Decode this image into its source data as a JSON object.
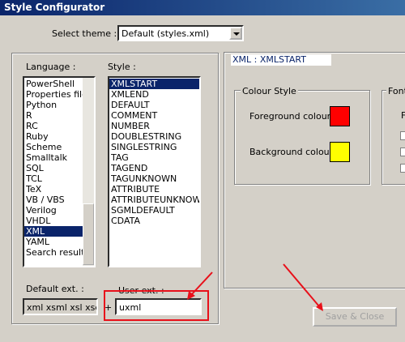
{
  "window": {
    "title": "Style Configurator"
  },
  "theme": {
    "label": "Select theme :",
    "value": "Default (styles.xml)"
  },
  "language": {
    "label": "Language :",
    "items": [
      "PowerShell",
      "Properties file",
      "Python",
      "R",
      "RC",
      "Ruby",
      "Scheme",
      "Smalltalk",
      "SQL",
      "TCL",
      "TeX",
      "VB / VBS",
      "Verilog",
      "VHDL",
      "XML",
      "YAML",
      "Search result"
    ],
    "selected": "XML"
  },
  "style": {
    "label": "Style :",
    "items": [
      "XMLSTART",
      "XMLEND",
      "DEFAULT",
      "COMMENT",
      "NUMBER",
      "DOUBLESTRING",
      "SINGLESTRING",
      "TAG",
      "TAGEND",
      "TAGUNKNOWN",
      "ATTRIBUTE",
      "ATTRIBUTEUNKNOWN",
      "SGMLDEFAULT",
      "CDATA"
    ],
    "selected": "XMLSTART"
  },
  "ext": {
    "default_label": "Default ext. :",
    "default_value": "xml xsml xsl xsd kml",
    "plus": "+",
    "user_label": "User ext. :",
    "user_value": "uxml"
  },
  "panel": {
    "header": "XML : XMLSTART",
    "colour_style": {
      "title": "Colour Style",
      "fg_label": "Foreground colour",
      "bg_label": "Background colour",
      "fg_color": "#ff0000",
      "bg_color": "#ffff00"
    },
    "font_style": {
      "title": "Font",
      "partial_label": "F"
    }
  },
  "buttons": {
    "save_close": "Save & Close"
  },
  "annotation": {
    "color": "#e8101a"
  }
}
